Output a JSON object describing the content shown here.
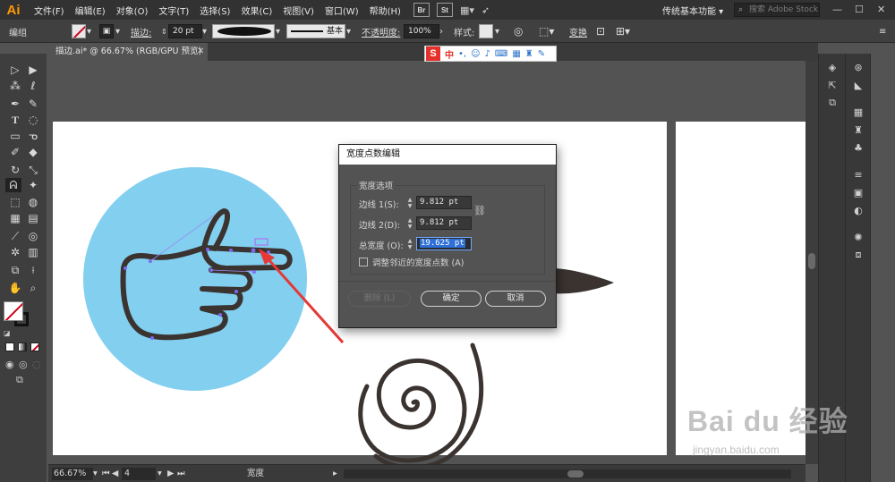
{
  "app": {
    "logo": "Ai",
    "workspace": "传统基本功能 ▾",
    "stock_search_placeholder": "搜索 Adobe Stock"
  },
  "menu": [
    "文件(F)",
    "编辑(E)",
    "对象(O)",
    "文字(T)",
    "选择(S)",
    "效果(C)",
    "视图(V)",
    "窗口(W)",
    "帮助(H)"
  ],
  "app_buttons": [
    "Br",
    "St"
  ],
  "control_bar": {
    "selection_label": "编组",
    "stroke_label": "描边:",
    "stroke_value": "20 pt",
    "stroke_style": "基本",
    "opacity_label": "不透明度:",
    "opacity_value": "100%",
    "style_label": "样式:",
    "transform_label": "变换"
  },
  "document_tab": {
    "title": "描边.ai* @ 66.67% (RGB/GPU 预览)",
    "close": "✕"
  },
  "ime_bar": {
    "logo": "S",
    "mode": "中"
  },
  "status_bar": {
    "zoom": "66.67%",
    "page": "4",
    "tool_name": "宽度"
  },
  "dialog": {
    "title": "宽度点数编辑",
    "group_title": "宽度选项",
    "side1_label": "边线 1(S):",
    "side1_value": "9.812 pt",
    "side2_label": "边线 2(D):",
    "side2_value": "9.812 pt",
    "total_label": "总宽度 (O):",
    "total_value": "19.625 pt",
    "adjust_label": "调整邻近的宽度点数 (A)",
    "delete_label": "删除 (L)",
    "ok_label": "确定",
    "cancel_label": "取消"
  },
  "watermark": {
    "logo": "Bai du 经验",
    "url": "jingyan.baidu.com"
  },
  "colors": {
    "circle": "#82cff0",
    "stroke": "#3a3330",
    "accent": "#ff9a00",
    "arrow": "#e53935"
  }
}
